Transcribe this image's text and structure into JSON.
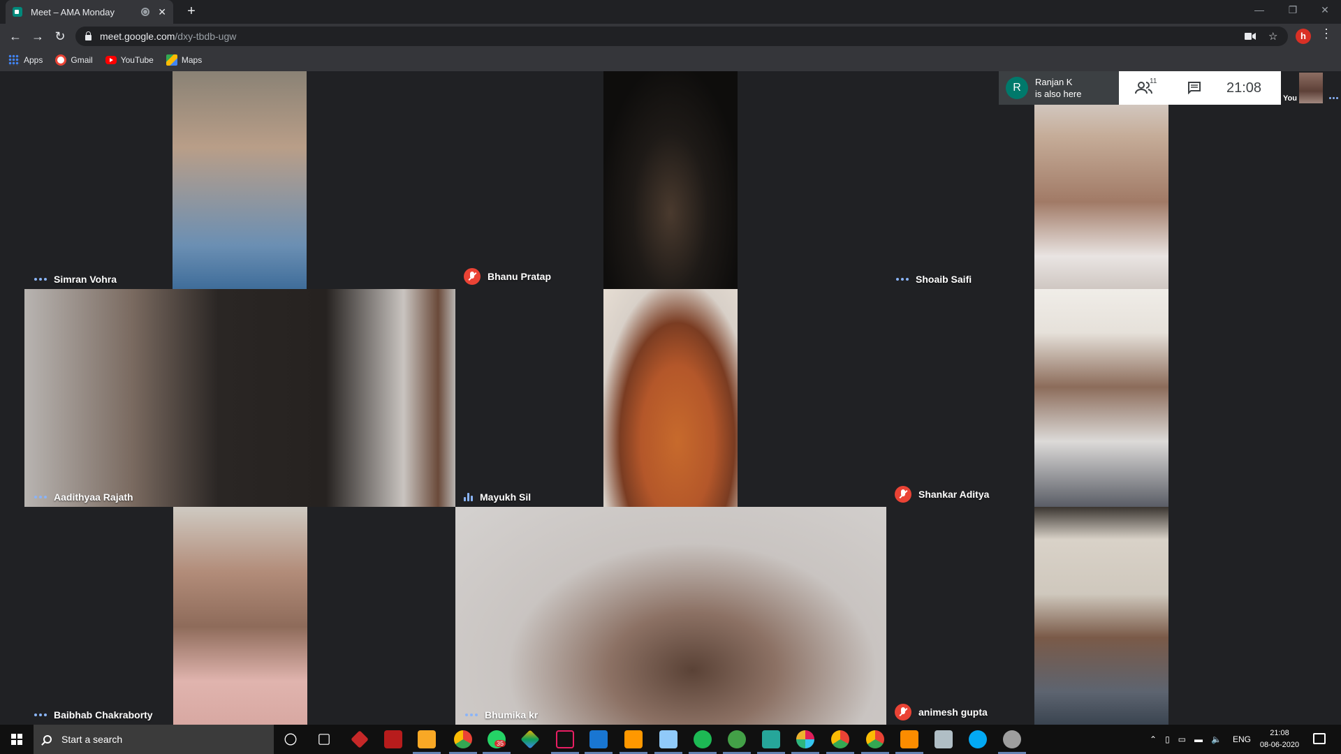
{
  "browser": {
    "tab_title": "Meet – AMA Monday",
    "url_host": "meet.google.com",
    "url_path": "/dxy-tbdb-ugw",
    "profile_initial": "h",
    "bookmarks": [
      {
        "label": "Apps",
        "icon": "apps-grid-icon"
      },
      {
        "label": "Gmail",
        "icon": "google-icon"
      },
      {
        "label": "YouTube",
        "icon": "youtube-icon"
      },
      {
        "label": "Maps",
        "icon": "maps-icon"
      }
    ]
  },
  "meet": {
    "notification": {
      "avatar": "R",
      "name": "Ranjan K",
      "text": "is also here"
    },
    "participant_count": "11",
    "clock": "21:08",
    "self_label": "You",
    "participants": [
      {
        "name": "Simran Vohra",
        "status": "more"
      },
      {
        "name": "Bhanu Pratap",
        "status": "muted"
      },
      {
        "name": "Shoaib Saifi",
        "status": "more"
      },
      {
        "name": "Aadithyaa Rajath",
        "status": "more"
      },
      {
        "name": "Mayukh Sil",
        "status": "speaking"
      },
      {
        "name": "Shankar Aditya",
        "status": "muted"
      },
      {
        "name": "Baibhab Chakraborty",
        "status": "more"
      },
      {
        "name": "Bhumika kr",
        "status": "more"
      },
      {
        "name": "animesh gupta",
        "status": "muted"
      }
    ]
  },
  "taskbar": {
    "search_placeholder": "Start a search",
    "whatsapp_badge": "35",
    "language": "ENG",
    "time": "21:08",
    "date": "08-06-2020"
  }
}
